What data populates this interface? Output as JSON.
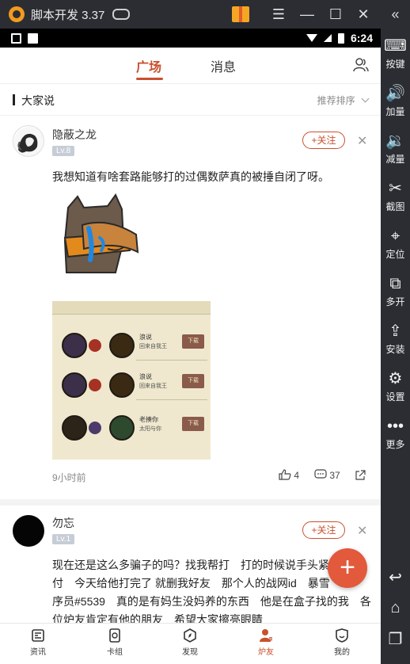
{
  "emulator": {
    "title": "脚本开发 3.37",
    "controls": {
      "menu": "☰",
      "minimize": "—",
      "maximize": "☐",
      "close": "✕",
      "collapse": "«"
    },
    "sidebar": [
      {
        "label": "按键",
        "icon": "keyboard-icon"
      },
      {
        "label": "加量",
        "icon": "volume-up-icon"
      },
      {
        "label": "减量",
        "icon": "volume-down-icon"
      },
      {
        "label": "截图",
        "icon": "scissors-icon"
      },
      {
        "label": "定位",
        "icon": "location-pin-icon"
      },
      {
        "label": "多开",
        "icon": "multi-instance-icon"
      },
      {
        "label": "安装",
        "icon": "apk-install-icon"
      },
      {
        "label": "设置",
        "icon": "gear-icon"
      },
      {
        "label": "更多",
        "icon": "more-dots-icon"
      }
    ]
  },
  "statusbar": {
    "time": "6:24"
  },
  "topnav": {
    "tabs": [
      "广场",
      "消息"
    ],
    "active": "广场"
  },
  "section": {
    "title": "大家说",
    "sort": "推荐排序"
  },
  "posts": [
    {
      "username": "隐蔽之龙",
      "level": "Lv.8",
      "follow": "+关注",
      "text": "我想知道有啥套路能够打的过偶数萨真的被捶自闭了呀。",
      "time": "9小时前",
      "likes": "4",
      "comments": "37",
      "screenshot_rows": [
        {
          "name": "浪说",
          "sub": "回来自我王",
          "btn": "下载"
        },
        {
          "name": "浪说",
          "sub": "回来自我王",
          "btn": "下载"
        },
        {
          "name": "老揍你",
          "sub": "太阳与你",
          "btn": "下载"
        }
      ]
    },
    {
      "username": "勿忘",
      "level": "Lv.1",
      "follow": "+关注",
      "lines": [
        "现在还是这么多骗子的吗？找我帮打　打的时候说手头紧",
        "付　今天给他打完了 就删我好友　那个人的战网id　暴雪",
        "序员#5539　真的是有妈生没妈养的东西　他是在盒子找的我　各",
        "位炉友肯定有他的朋友　希望大家擦亮眼睛"
      ]
    }
  ],
  "bottomnav": [
    {
      "label": "资讯",
      "icon": "news-icon"
    },
    {
      "label": "卡组",
      "icon": "deck-icon"
    },
    {
      "label": "发现",
      "icon": "compass-icon"
    },
    {
      "label": "炉友",
      "icon": "friends-icon"
    },
    {
      "label": "我的",
      "icon": "profile-icon"
    }
  ],
  "bottomnav_active": "炉友",
  "colors": {
    "accent": "#c8502e",
    "fab": "#e2593b",
    "chrome": "#2b2d33"
  }
}
